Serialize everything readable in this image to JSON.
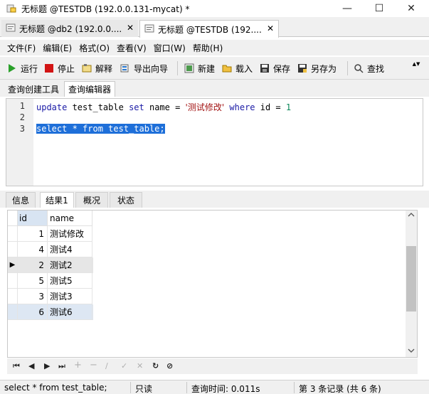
{
  "window": {
    "title": "无标题 @TESTDB (192.0.0.131-mycat) *",
    "controls": {
      "minimize": "—",
      "maximize": "☐",
      "close": "✕"
    }
  },
  "doc_tabs": [
    {
      "label": "无标题 @db2 (192.0.0....",
      "close": "✕"
    },
    {
      "label": "无标题 @TESTDB (192....",
      "close": "✕"
    }
  ],
  "menu": [
    "文件(F)",
    "编辑(E)",
    "格式(O)",
    "查看(V)",
    "窗口(W)",
    "帮助(H)"
  ],
  "toolbar": {
    "run": "运行",
    "stop": "停止",
    "explain": "解释",
    "export_wizard": "导出向导",
    "new": "新建",
    "load": "载入",
    "save": "保存",
    "save_as": "另存为",
    "find": "查找",
    "more": "▲▼"
  },
  "editor_tabs": [
    "查询创建工具",
    "查询编辑器"
  ],
  "editor": {
    "line_numbers": [
      "1",
      "2",
      "3"
    ],
    "line1": {
      "kw_update": "update",
      "t1": " test_table ",
      "kw_set": "set",
      "t2": " name = ",
      "str": "'测试修改'",
      "sp": " ",
      "kw_where": "where",
      "t3": " id = ",
      "num": "1"
    },
    "line3": "select * from test_table;"
  },
  "result_tabs": [
    "信息",
    "结果1",
    "概况",
    "状态"
  ],
  "grid": {
    "columns": [
      "id",
      "name"
    ],
    "rows": [
      {
        "id": "1",
        "name": "测试修改"
      },
      {
        "id": "4",
        "name": "测试4"
      },
      {
        "id": "2",
        "name": "测试2"
      },
      {
        "id": "5",
        "name": "测试5"
      },
      {
        "id": "3",
        "name": "测试3"
      },
      {
        "id": "6",
        "name": "测试6"
      }
    ],
    "current_row_marker": "▶"
  },
  "nav": {
    "first": "⏮",
    "prev": "◀",
    "next": "▶",
    "last": "⏭",
    "add": "+",
    "delete": "−",
    "edit": "∕",
    "apply": "✓",
    "cancel": "✕",
    "refresh": "↻",
    "stop": "⊘"
  },
  "status": {
    "query": "select * from test_table;",
    "mode": "只读",
    "time": "查询时间: 0.011s",
    "records": "第 3 条记录 (共 6 条)"
  },
  "colors": {
    "accent_selection": "#1e6fd9",
    "keyword": "#1a1aa6",
    "string": "#a31515",
    "number": "#098658",
    "run_green": "#2aa02a",
    "stop_red": "#d21414"
  }
}
